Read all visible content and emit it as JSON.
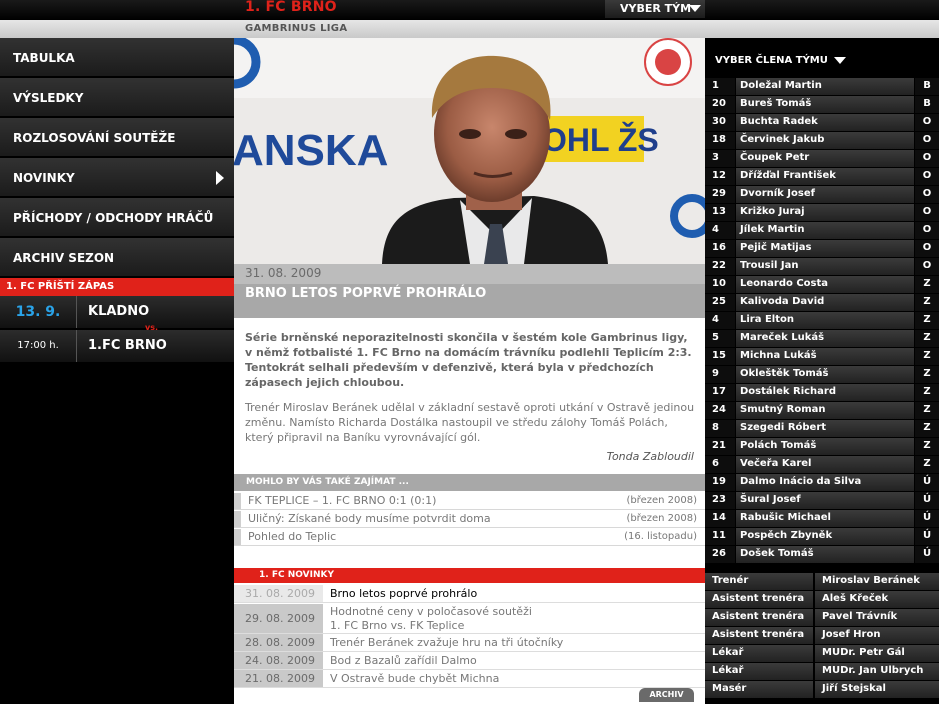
{
  "header": {
    "team_title": "1. FC BRNO",
    "team_select_label": "VYBER TÝM",
    "league": "GAMBRINUS LIGA"
  },
  "nav": {
    "items": [
      {
        "label": "TABULKA"
      },
      {
        "label": "VÝSLEDKY"
      },
      {
        "label": "ROZLOSOVÁNÍ SOUTĚŽE"
      },
      {
        "label": "NOVINKY"
      },
      {
        "label": "PŘÍCHODY / ODCHODY HRÁČŮ"
      },
      {
        "label": "ARCHIV SEZON"
      }
    ]
  },
  "next_match": {
    "heading": "1. FC PŘÍŠTÍ ZÁPAS",
    "date": "13. 9.",
    "time": "17:00 h.",
    "home": "KLADNO",
    "vs": "vs.",
    "away": "1.FC BRNO"
  },
  "article": {
    "photo_banner_left": "ANSKA",
    "photo_banner_right": "OHL ŽS",
    "date": "31. 08. 2009",
    "title": "BRNO LETOS POPRVÉ PROHRÁLO",
    "lead": "Série brněnské neporazitelnosti skončila v šestém kole Gambrinus ligy, v němž fotbalisté 1. FC Brno na domácím trávníku podlehli Teplicím 2:3. Tentokrát selhali především v defenzivě, která byla v předchozích zápasech jejich chloubou.",
    "body": "Trenér Miroslav Beránek udělal v základní sestavě oproti utkání v Ostravě jedinou změnu. Namísto Richarda Dostálka nastoupil ve středu zálohy Tomáš Polách, který připravil na Baníku vyrovnávající gól.",
    "author": "Tonda Zabloudil"
  },
  "also": {
    "heading": "MOHLO BY VÁS TAKÉ ZAJÍMAT ...",
    "items": [
      {
        "title": "FK TEPLICE – 1. FC BRNO 0:1 (0:1)",
        "date": "(březen 2008)"
      },
      {
        "title": "Uličný: Získané body musíme potvrdit doma",
        "date": "(březen 2008)"
      },
      {
        "title": "Pohled do Teplic",
        "date": "(16. listopadu)"
      }
    ]
  },
  "news": {
    "heading": "1. FC NOVINKY",
    "items": [
      {
        "date": "31. 08. 2009",
        "title": "Brno letos poprvé prohrálo",
        "title2": ""
      },
      {
        "date": "29. 08. 2009",
        "title": "Hodnotné ceny v poločasové soutěži",
        "title2": "1. FC Brno vs. FK Teplice"
      },
      {
        "date": "28. 08. 2009",
        "title": "Trenér Beránek zvažuje hru na tři útočníky",
        "title2": ""
      },
      {
        "date": "24. 08. 2009",
        "title": "Bod z Bazalů zařídil Dalmo",
        "title2": ""
      },
      {
        "date": "21. 08. 2009",
        "title": "V Ostravě bude chybět Michna",
        "title2": ""
      }
    ],
    "archive_label": "ARCHIV"
  },
  "roster": {
    "select_label": "VYBER ČLENA TÝMU",
    "players": [
      {
        "num": "1",
        "name": "Doležal Martin",
        "pos": "B"
      },
      {
        "num": "20",
        "name": "Bureš Tomáš",
        "pos": "B"
      },
      {
        "num": "30",
        "name": "Buchta Radek",
        "pos": "O"
      },
      {
        "num": "18",
        "name": "Červinek Jakub",
        "pos": "O"
      },
      {
        "num": "3",
        "name": "Čoupek Petr",
        "pos": "O"
      },
      {
        "num": "12",
        "name": "Dřížďal František",
        "pos": "O"
      },
      {
        "num": "29",
        "name": "Dvorník Josef",
        "pos": "O"
      },
      {
        "num": "13",
        "name": "Križko Juraj",
        "pos": "O"
      },
      {
        "num": "4",
        "name": "Jílek Martin",
        "pos": "O"
      },
      {
        "num": "16",
        "name": "Pejič Matijas",
        "pos": "O"
      },
      {
        "num": "22",
        "name": "Trousil Jan",
        "pos": "O"
      },
      {
        "num": "10",
        "name": "Leonardo Costa",
        "pos": "Z"
      },
      {
        "num": "25",
        "name": "Kalivoda David",
        "pos": "Z"
      },
      {
        "num": "4",
        "name": "Lira Elton",
        "pos": "Z"
      },
      {
        "num": "5",
        "name": "Mareček Lukáš",
        "pos": "Z"
      },
      {
        "num": "15",
        "name": "Michna Lukáš",
        "pos": "Z"
      },
      {
        "num": "9",
        "name": "Okleštěk Tomáš",
        "pos": "Z"
      },
      {
        "num": "17",
        "name": "Dostálek Richard",
        "pos": "Z"
      },
      {
        "num": "24",
        "name": "Smutný Roman",
        "pos": "Z"
      },
      {
        "num": "8",
        "name": "Szegedi Róbert",
        "pos": "Z"
      },
      {
        "num": "21",
        "name": "Polách Tomáš",
        "pos": "Z"
      },
      {
        "num": "6",
        "name": "Večeřa Karel",
        "pos": "Z"
      },
      {
        "num": "19",
        "name": "Dalmo Inácio da Silva",
        "pos": "Ú"
      },
      {
        "num": "23",
        "name": "Šural Josef",
        "pos": "Ú"
      },
      {
        "num": "14",
        "name": "Rabušic Michael",
        "pos": "Ú"
      },
      {
        "num": "11",
        "name": "Pospěch Zbyněk",
        "pos": "Ú"
      },
      {
        "num": "26",
        "name": "Došek Tomáš",
        "pos": "Ú"
      }
    ],
    "staff": [
      {
        "role": "Trenér",
        "name": "Miroslav Beránek"
      },
      {
        "role": "Asistent trenéra",
        "name": "Aleš Křeček"
      },
      {
        "role": "Asistent trenéra",
        "name": "Pavel Trávník"
      },
      {
        "role": "Asistent trenéra",
        "name": "Josef Hron"
      },
      {
        "role": "Lékař",
        "name": "MUDr. Petr Gál"
      },
      {
        "role": "Lékař",
        "name": "MUDr. Jan Ulbrych"
      },
      {
        "role": "Masér",
        "name": "Jiří Stejskal"
      }
    ]
  }
}
